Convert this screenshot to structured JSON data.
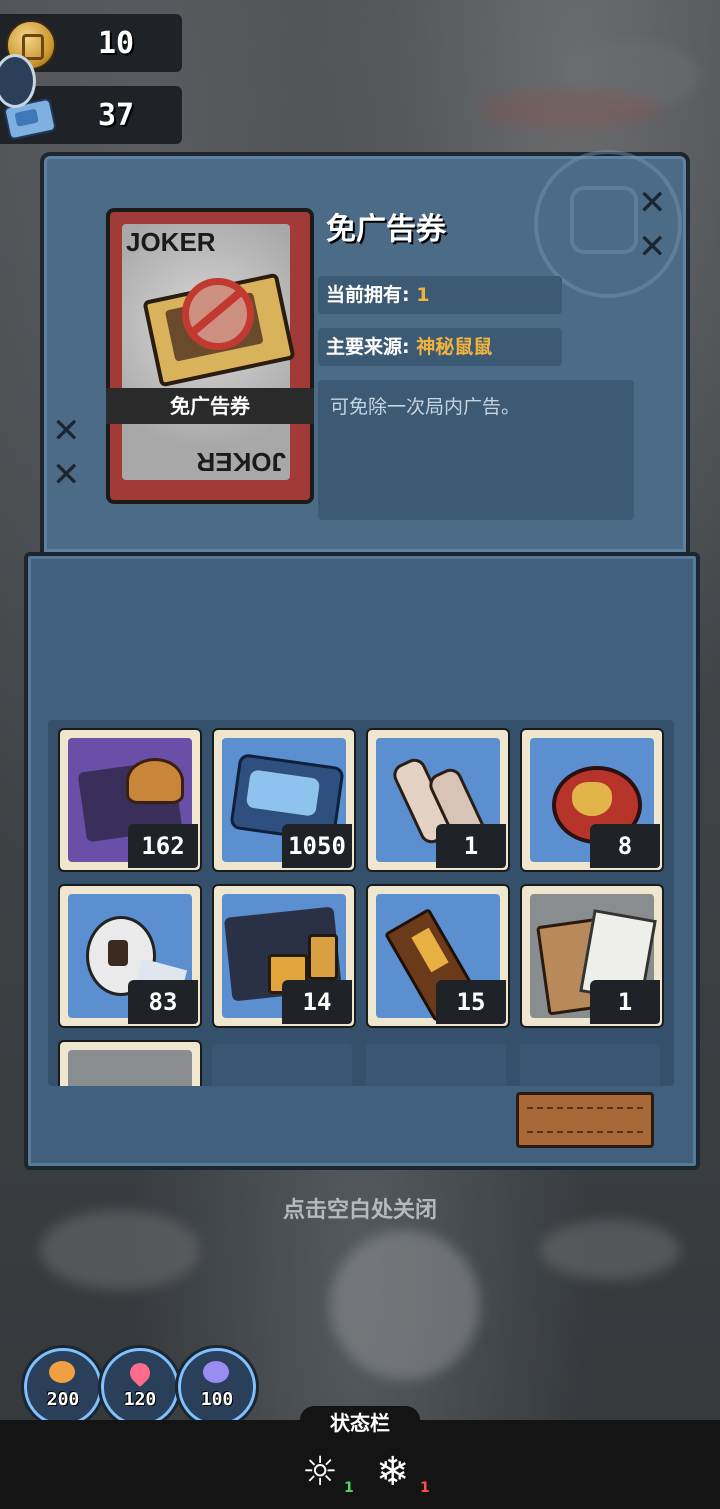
{
  "currency": {
    "coins": {
      "icon": "gold-coin-icon",
      "value": "10"
    },
    "tickets": {
      "icon": "blue-ticket-icon",
      "value": "37"
    }
  },
  "item_detail": {
    "card_vertical_text": "JOKER",
    "card_label": "免广告券",
    "title": "免广告券",
    "owned_label": "当前拥有:",
    "owned_value": "1",
    "source_label": "主要来源:",
    "source_value": "神秘鼠鼠",
    "description": "可免除一次局内广告。"
  },
  "inventory": [
    {
      "name": "fast-food-bag",
      "count": "162",
      "bg": "purple"
    },
    {
      "name": "blue-packet",
      "count": "1050",
      "bg": "blue"
    },
    {
      "name": "bandage-rolls",
      "count": "1",
      "bg": "blue"
    },
    {
      "name": "cat-badge-can",
      "count": "8",
      "bg": "blue"
    },
    {
      "name": "toilet-paper",
      "count": "83",
      "bg": "blue"
    },
    {
      "name": "food-tray-bag",
      "count": "14",
      "bg": "blue"
    },
    {
      "name": "chocolate-bar",
      "count": "15",
      "bg": "blue"
    },
    {
      "name": "document-envelope",
      "count": "1",
      "bg": "gray"
    }
  ],
  "close_hint": "点击空白处关闭",
  "stats": [
    {
      "name": "hunger",
      "icon": "food-icon",
      "value": "200",
      "color": "#f0a040"
    },
    {
      "name": "health",
      "icon": "heart-icon",
      "value": "120",
      "color": "#ff6b8a"
    },
    {
      "name": "sanity",
      "icon": "brain-icon",
      "value": "100",
      "color": "#9a8cf0"
    }
  ],
  "status_bar": {
    "label": "状态栏",
    "effects": [
      {
        "icon": "sun-icon",
        "level": "1",
        "color": "#4cd964"
      },
      {
        "icon": "snowflake-icon",
        "level": "1",
        "color": "#ff4d4d"
      }
    ]
  }
}
